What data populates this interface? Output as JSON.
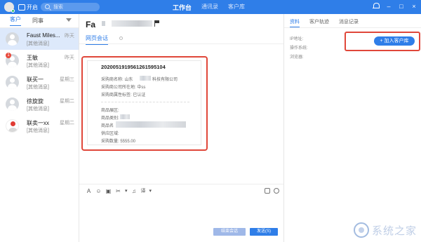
{
  "topbar": {
    "status_label": "开启",
    "search_placeholder": "搜索",
    "nav": [
      "工作台",
      "通讯录",
      "客户库"
    ],
    "nav_active": "工作台",
    "controls": [
      "–",
      "□",
      "×"
    ]
  },
  "sidebar": {
    "tabs": [
      "客户",
      "同事"
    ],
    "contacts": [
      {
        "name": "Faust Miles...",
        "msg": "[其他消息]",
        "time": "昨天",
        "selected": true,
        "badge": ""
      },
      {
        "name": "王敏",
        "msg": "[其他消息]",
        "time": "昨天",
        "selected": false,
        "badge": "1"
      },
      {
        "name": "联买一",
        "msg": "[其他消息]",
        "time": "星期三",
        "selected": false,
        "badge": ""
      },
      {
        "name": "徐旋旋",
        "msg": "[其他消息]",
        "time": "星期二",
        "selected": false,
        "badge": ""
      },
      {
        "name": "联卖一xx",
        "msg": "[其他消息]",
        "time": "星期二",
        "selected": false,
        "badge": ""
      }
    ]
  },
  "chat": {
    "title": "Fa",
    "tab": "网页会话",
    "card": {
      "order_no": "2020051919561261595104",
      "buyer_name_prefix": "采购商名称: 山东",
      "buyer_name_suffix": "科技有限公司",
      "buyer_location": "采购商公司所在地: 中ss",
      "buyer_attr": "采购商属性标签: 已认证",
      "product_section": "商品展区:",
      "product_cat": "商品类别:",
      "product_name": "商品名",
      "supply_area": "供应区域:",
      "purchase_qty": "采购数量: 5555.00"
    },
    "toolbar": [
      "A",
      "☺",
      "▣",
      "✂",
      "▾",
      "♫",
      "译",
      "▾"
    ],
    "end_button": "结束会话",
    "send_button": "发送(S)"
  },
  "right_panel": {
    "tabs": [
      "资料",
      "客户轨迹",
      "消息记录"
    ],
    "links": [
      "IP地址:",
      "操作系统:",
      "浏览器:"
    ],
    "add_button": "+ 加入客户库"
  },
  "watermark": {
    "text": "系统之家"
  }
}
